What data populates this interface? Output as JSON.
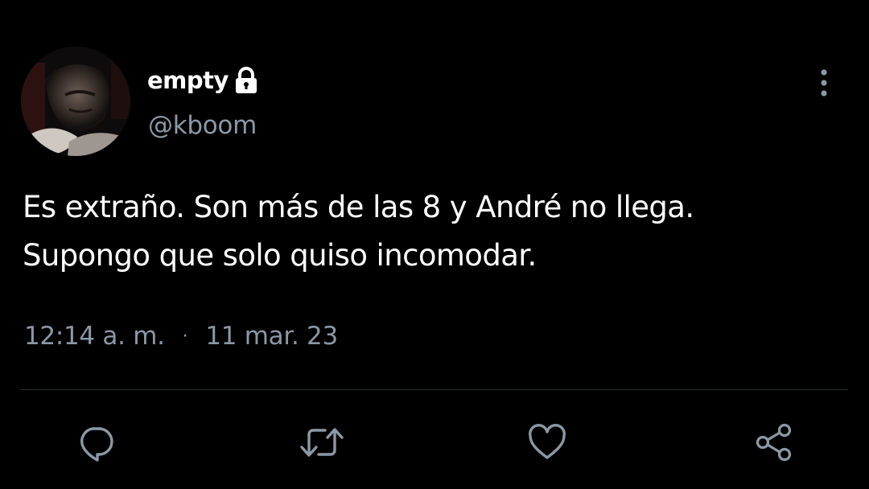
{
  "author": {
    "display_name": "empty",
    "handle": "@kboom",
    "protected": true,
    "avatar": "profile-photo",
    "lock_icon": "lock-icon"
  },
  "tweet": {
    "text": "Es extraño. Son más de las 8 y André no llega.\nSupongo que solo quiso incomodar.",
    "time": "12:14 a. m.",
    "separator": "·",
    "date": "11 mar. 23"
  },
  "menu_icon": "more-vertical-icon",
  "actions": {
    "reply_icon": "reply-icon",
    "retweet_icon": "retweet-icon",
    "like_icon": "heart-icon",
    "share_icon": "share-icon"
  },
  "colors": {
    "background": "#000000",
    "primary_text": "#ffffff",
    "secondary_text": "#8b98a5",
    "divider": "#2f3336",
    "icon": "#8b98a5"
  }
}
